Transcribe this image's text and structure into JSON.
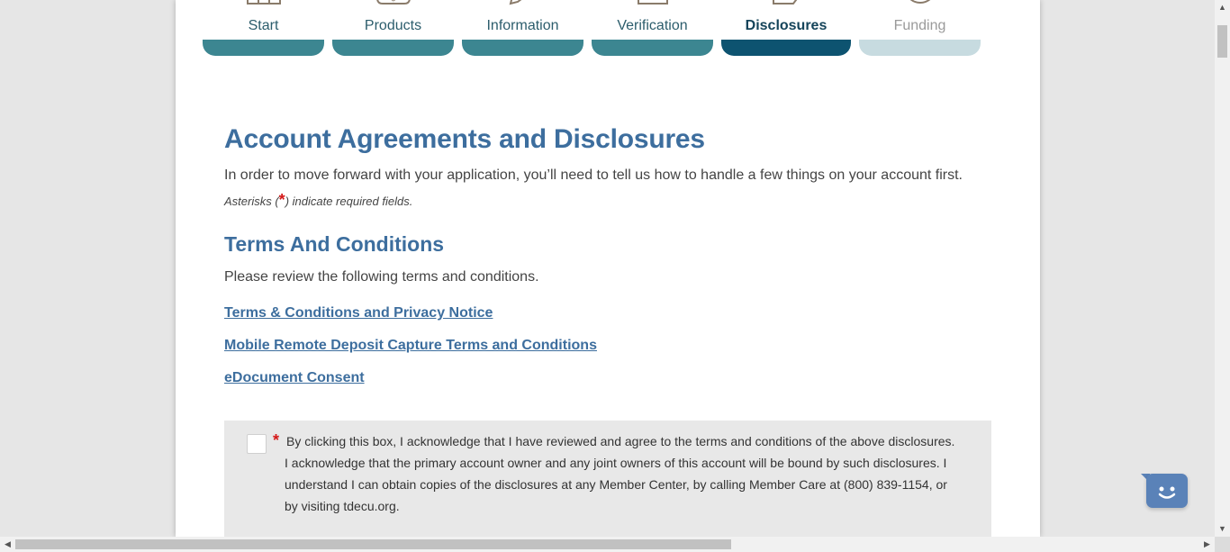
{
  "stepper": {
    "steps": [
      {
        "label": "Start",
        "icon": "bank-icon",
        "state": "complete"
      },
      {
        "label": "Products",
        "icon": "dollar-card-icon",
        "state": "complete"
      },
      {
        "label": "Information",
        "icon": "pencil-icon",
        "state": "complete"
      },
      {
        "label": "Verification",
        "icon": "id-card-icon",
        "state": "complete"
      },
      {
        "label": "Disclosures",
        "icon": "document-icon",
        "state": "active"
      },
      {
        "label": "Funding",
        "icon": "plus-circle-icon",
        "state": "disabled"
      }
    ]
  },
  "main": {
    "title": "Account Agreements and Disclosures",
    "intro": "In order to move forward with your application, you’ll need to tell us how to handle a few things on your account first.",
    "required_note_prefix": "Asterisks (",
    "required_note_star": "*",
    "required_note_suffix": ") indicate required fields."
  },
  "terms": {
    "title": "Terms And Conditions",
    "description": "Please review the following terms and conditions.",
    "links": [
      "Terms & Conditions and Privacy Notice",
      "Mobile Remote Deposit Capture Terms and Conditions",
      "eDocument Consent"
    ],
    "acknowledgement": {
      "required_star": "*",
      "checked": false,
      "text": "By clicking this box, I acknowledge that I have reviewed and agree to the terms and conditions of the above disclosures. I acknowledge that the primary account owner and any joint owners of this account will be bound by such disclosures. I understand I can obtain copies of the disclosures at any Member Center, by calling Member Care at (800) 839-1154, or by visiting tdecu.org."
    }
  },
  "chat": {
    "icon": "chat-smiley-icon"
  },
  "colors": {
    "accent": "#3d6e9e",
    "step_complete": "#3c8691",
    "step_active": "#0d5370",
    "step_disabled": "#c7dbe0",
    "required": "#d41818"
  }
}
